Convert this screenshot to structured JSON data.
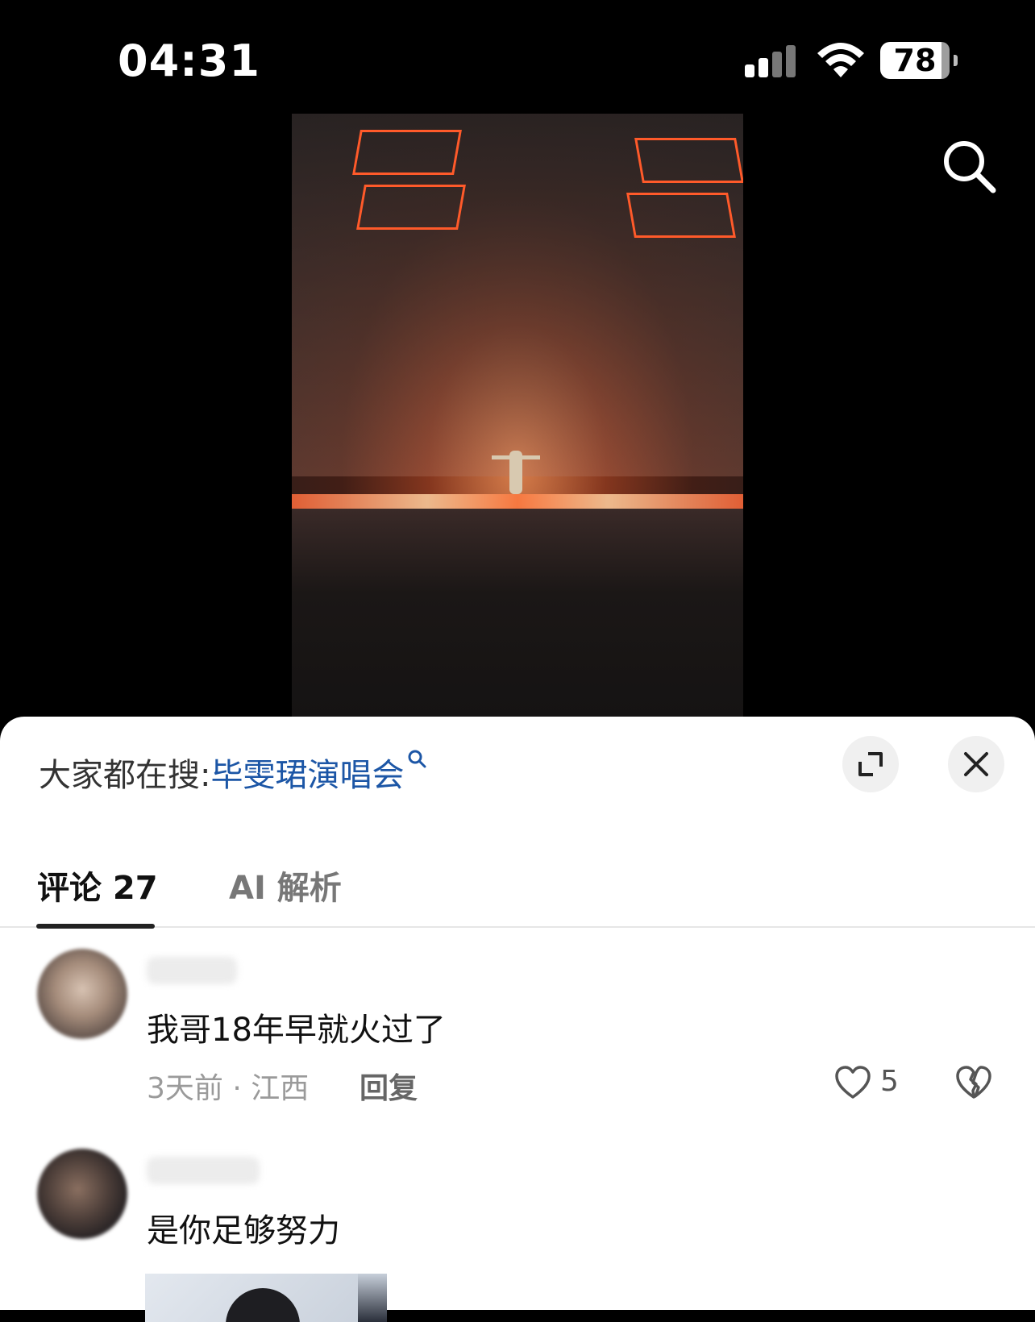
{
  "status_bar": {
    "time": "04:31",
    "battery": "78"
  },
  "search_bar": {
    "prefix": "大家都在搜:",
    "keyword": "毕雯珺演唱会"
  },
  "tabs": [
    {
      "label": "评论 27",
      "active": true
    },
    {
      "label": "AI 解析",
      "active": false
    }
  ],
  "comments": [
    {
      "text": "我哥18年早就火过了",
      "meta": "3天前 · 江西",
      "reply": "回复",
      "likes": "5"
    },
    {
      "text": "是你足够努力"
    }
  ],
  "colors": {
    "keyword": "#1c56a6",
    "accent_underline": "#222222"
  },
  "icons": {
    "top_search": "search-icon",
    "expand": "expand-icon",
    "close": "close-icon",
    "like": "heart-icon",
    "dislike": "broken-heart-icon"
  }
}
